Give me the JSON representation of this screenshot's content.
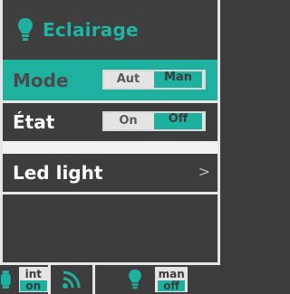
{
  "header": {
    "title": "Eclairage",
    "icon": "lightbulb-icon"
  },
  "rows": {
    "mode": {
      "label": "Mode",
      "options": [
        "Aut",
        "Man"
      ],
      "selected": "Man"
    },
    "etat": {
      "label": "État",
      "options": [
        "On",
        "Off"
      ],
      "selected": "Off"
    },
    "led": {
      "label": "Led light",
      "chevron": ">"
    }
  },
  "bottom": {
    "int_top": "int",
    "int_bot": "on",
    "man_top": "man",
    "man_bot": "off"
  },
  "colors": {
    "accent": "#1eb1a0",
    "bg": "#3d3d3d"
  }
}
